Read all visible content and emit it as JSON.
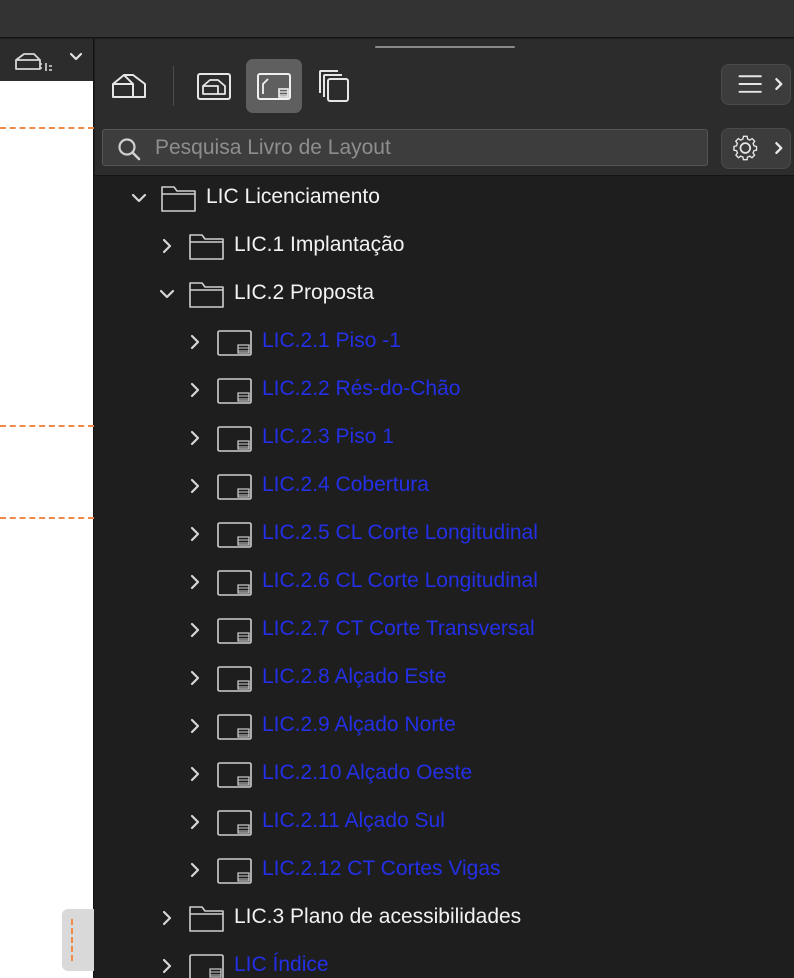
{
  "search": {
    "placeholder": "Pesquisa Livro de Layout",
    "value": ""
  },
  "toolbar": {
    "buttons": [
      {
        "name": "project-map-button",
        "icon": "house-icon",
        "active": false
      },
      {
        "name": "view-map-button",
        "icon": "view-icon",
        "active": false
      },
      {
        "name": "layout-book-button",
        "icon": "layout-icon",
        "active": true
      },
      {
        "name": "publisher-sets-button",
        "icon": "stack-icon",
        "active": false
      }
    ],
    "menu_icon": "menu-icon",
    "settings_icon": "gear-icon"
  },
  "tree": {
    "items": [
      {
        "label": "LIC Licenciamento",
        "type": "folder",
        "level": 0,
        "expanded": true
      },
      {
        "label": "LIC.1 Implantação",
        "type": "folder",
        "level": 1,
        "expanded": false
      },
      {
        "label": "LIC.2 Proposta",
        "type": "folder",
        "level": 1,
        "expanded": true
      },
      {
        "label": "LIC.2.1 Piso -1",
        "type": "layout",
        "level": 2,
        "expanded": false
      },
      {
        "label": "LIC.2.2 Rés-do-Chão",
        "type": "layout",
        "level": 2,
        "expanded": false
      },
      {
        "label": "LIC.2.3 Piso 1",
        "type": "layout",
        "level": 2,
        "expanded": false
      },
      {
        "label": "LIC.2.4 Cobertura",
        "type": "layout",
        "level": 2,
        "expanded": false
      },
      {
        "label": "LIC.2.5 CL Corte Longitudinal",
        "type": "layout",
        "level": 2,
        "expanded": false
      },
      {
        "label": "LIC.2.6 CL Corte Longitudinal",
        "type": "layout",
        "level": 2,
        "expanded": false
      },
      {
        "label": "LIC.2.7 CT Corte Transversal",
        "type": "layout",
        "level": 2,
        "expanded": false
      },
      {
        "label": "LIC.2.8 Alçado Este",
        "type": "layout",
        "level": 2,
        "expanded": false
      },
      {
        "label": "LIC.2.9 Alçado Norte",
        "type": "layout",
        "level": 2,
        "expanded": false
      },
      {
        "label": "LIC.2.10 Alçado Oeste",
        "type": "layout",
        "level": 2,
        "expanded": false
      },
      {
        "label": "LIC.2.11 Alçado Sul",
        "type": "layout",
        "level": 2,
        "expanded": false
      },
      {
        "label": "LIC.2.12 CT Cortes Vigas",
        "type": "layout",
        "level": 2,
        "expanded": false
      },
      {
        "label": "LIC.3 Plano de acessibilidades",
        "type": "folder",
        "level": 1,
        "expanded": false
      },
      {
        "label": "LIC Índice",
        "type": "layout",
        "level": 1,
        "expanded": false
      }
    ]
  },
  "colors": {
    "panel_bg": "#1e1e1e",
    "folder_text": "#f2f2f2",
    "layout_text": "#2330e6",
    "guide_line": "#f08a4b"
  }
}
